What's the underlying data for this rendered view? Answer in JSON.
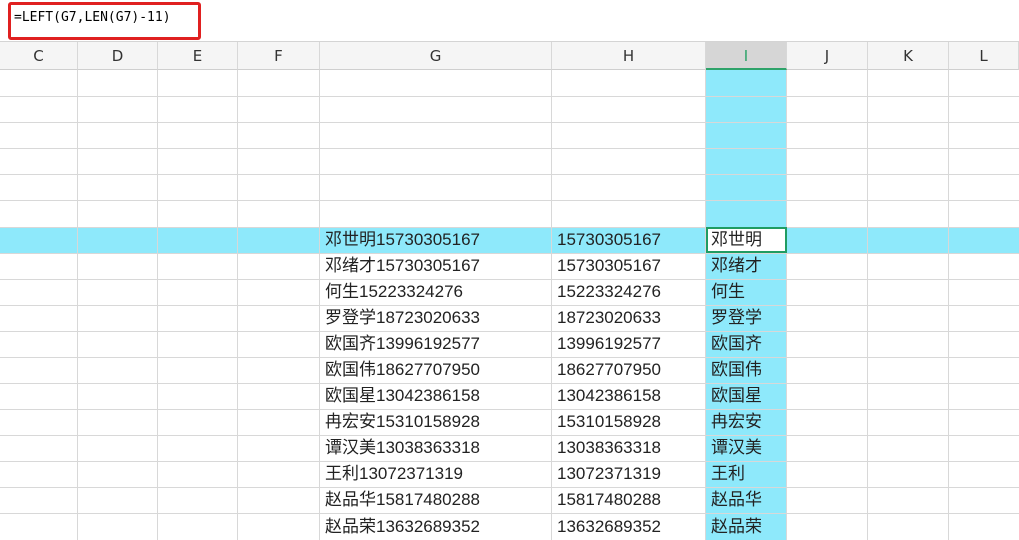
{
  "formula_bar": {
    "formula": "=LEFT(G7,LEN(G7)-11)"
  },
  "columns": [
    "C",
    "D",
    "E",
    "F",
    "G",
    "H",
    "I",
    "J",
    "K",
    "L"
  ],
  "selected_column": "I",
  "rows": [
    {
      "g": "邓世明15730305167",
      "h": "15730305167",
      "i": "邓世明"
    },
    {
      "g": "邓绪才15730305167",
      "h": "15730305167",
      "i": "邓绪才"
    },
    {
      "g": "何生15223324276",
      "h": "15223324276",
      "i": "何生"
    },
    {
      "g": "罗登学18723020633",
      "h": "18723020633",
      "i": "罗登学"
    },
    {
      "g": "欧国齐13996192577",
      "h": "13996192577",
      "i": "欧国齐"
    },
    {
      "g": "欧国伟18627707950",
      "h": "18627707950",
      "i": "欧国伟"
    },
    {
      "g": "欧国星13042386158",
      "h": "13042386158",
      "i": "欧国星"
    },
    {
      "g": "冉宏安15310158928",
      "h": "15310158928",
      "i": "冉宏安"
    },
    {
      "g": "谭汉美13038363318",
      "h": "13038363318",
      "i": "谭汉美"
    },
    {
      "g": "王利13072371319",
      "h": "13072371319",
      "i": "王利"
    },
    {
      "g": "赵品华15817480288",
      "h": "15817480288",
      "i": "赵品华"
    },
    {
      "g": "赵品荣13632689352",
      "h": "13632689352",
      "i": "赵品荣"
    }
  ],
  "colors": {
    "highlight": "#8ee9fb",
    "formula_box": "#e02020",
    "active_cell": "#1f9c62"
  }
}
